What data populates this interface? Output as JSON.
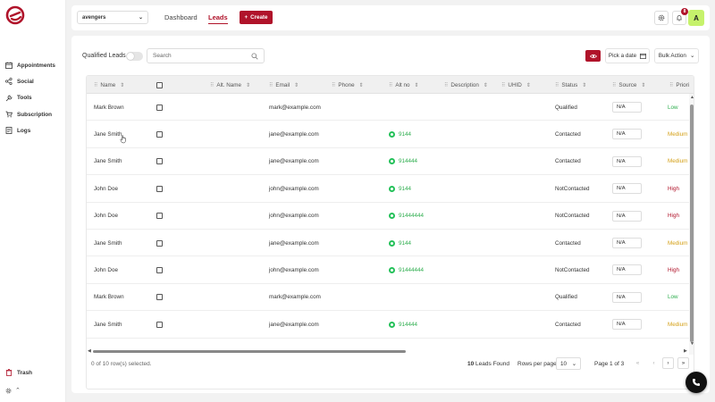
{
  "sidebar": {
    "items": [
      {
        "label": "Appointments",
        "icon": "calendar-icon"
      },
      {
        "label": "Social",
        "icon": "share-icon"
      },
      {
        "label": "Tools",
        "icon": "wrench-icon"
      },
      {
        "label": "Subscription",
        "icon": "cart-icon"
      },
      {
        "label": "Logs",
        "icon": "log-icon"
      }
    ],
    "trash_label": "Trash"
  },
  "topbar": {
    "project": "avengers",
    "tabs": [
      "Dashboard",
      "Leads"
    ],
    "active_tab": "Leads",
    "create_label": "Create",
    "notification_count": "8",
    "avatar_initial": "A"
  },
  "toolbar": {
    "qualified_leads_label": "Qualified Leads",
    "search_placeholder": "Search",
    "pick_date_label": "Pick a date",
    "bulk_action_label": "Bulk Action"
  },
  "table": {
    "columns": [
      "Name",
      "",
      "Alt. Name",
      "Email",
      "Phone",
      "Alt no",
      "Description",
      "UHID",
      "Status",
      "Source",
      "Priori"
    ],
    "rows": [
      {
        "name": "Mark Brown",
        "email": "mark@example.com",
        "alt_no": "",
        "status": "Qualified",
        "source": "N/A",
        "priority": "Low"
      },
      {
        "name": "Jane Smith",
        "email": "jane@example.com",
        "alt_no": "9144",
        "status": "Contacted",
        "source": "N/A",
        "priority": "Medium"
      },
      {
        "name": "Jane Smith",
        "email": "jane@example.com",
        "alt_no": "914444",
        "status": "Contacted",
        "source": "N/A",
        "priority": "Medium"
      },
      {
        "name": "John Doe",
        "email": "john@example.com",
        "alt_no": "9144",
        "status": "NotContacted",
        "source": "N/A",
        "priority": "High"
      },
      {
        "name": "John Doe",
        "email": "john@example.com",
        "alt_no": "91444444",
        "status": "NotContacted",
        "source": "N/A",
        "priority": "High"
      },
      {
        "name": "Jane Smith",
        "email": "jane@example.com",
        "alt_no": "9144",
        "status": "Contacted",
        "source": "N/A",
        "priority": "Medium"
      },
      {
        "name": "John Doe",
        "email": "john@example.com",
        "alt_no": "91444444",
        "status": "NotContacted",
        "source": "N/A",
        "priority": "High"
      },
      {
        "name": "Mark Brown",
        "email": "mark@example.com",
        "alt_no": "",
        "status": "Qualified",
        "source": "N/A",
        "priority": "Low"
      },
      {
        "name": "Jane Smith",
        "email": "jane@example.com",
        "alt_no": "914444",
        "status": "Contacted",
        "source": "N/A",
        "priority": "Medium"
      }
    ]
  },
  "footer": {
    "selected_text": "0 of 10 row(s) selected.",
    "leads_count": "10",
    "leads_found_label": "Leads Found",
    "rows_per_page_label": "Rows per page",
    "rows_per_page_value": "10",
    "page_info": "Page 1 of 3"
  },
  "colors": {
    "brand": "#b0132a",
    "low": "#2eae4e",
    "medium": "#d4a017",
    "high": "#b0132a"
  }
}
